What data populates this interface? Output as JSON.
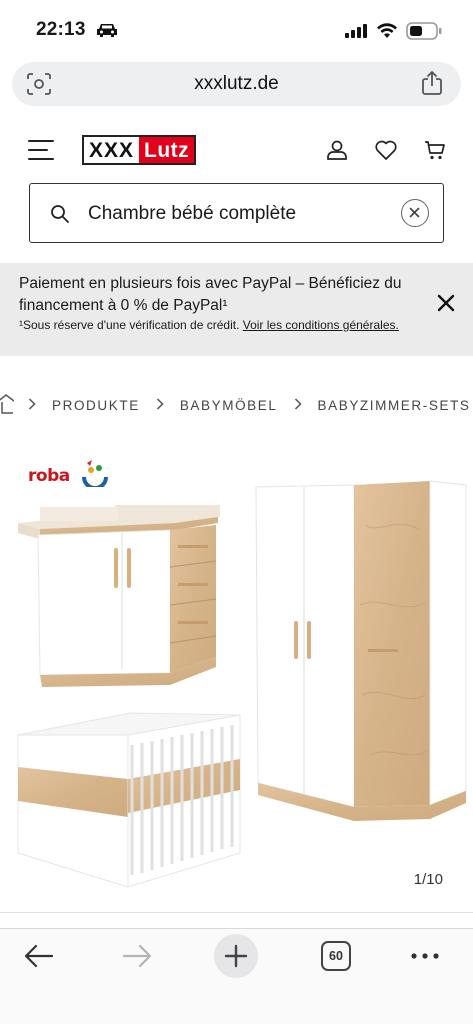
{
  "status_bar": {
    "time": "22:13"
  },
  "browser": {
    "url": "xxxlutz.de"
  },
  "site": {
    "logo_left": "XXX",
    "logo_right": "Lutz"
  },
  "search": {
    "query": "Chambre bébé complète"
  },
  "banner": {
    "line1": "Paiement en plusieurs fois avec PayPal – Bénéficiez du financement à 0 % de PayPal¹",
    "line2_prefix": "¹Sous réserve d'une vérification de crédit. ",
    "line2_link": "Voir les conditions générales."
  },
  "breadcrumb": {
    "items": [
      "PRODUKTE",
      "BABYMÖBEL",
      "BABYZIMMER-SETS"
    ]
  },
  "product": {
    "brand": "roba",
    "image_counter": "1/10"
  },
  "toolbar": {
    "tabs_count": "60"
  },
  "colors": {
    "brand_red": "#e3001b",
    "banner_bg": "#ebebeb",
    "oak": "#d9b993"
  }
}
